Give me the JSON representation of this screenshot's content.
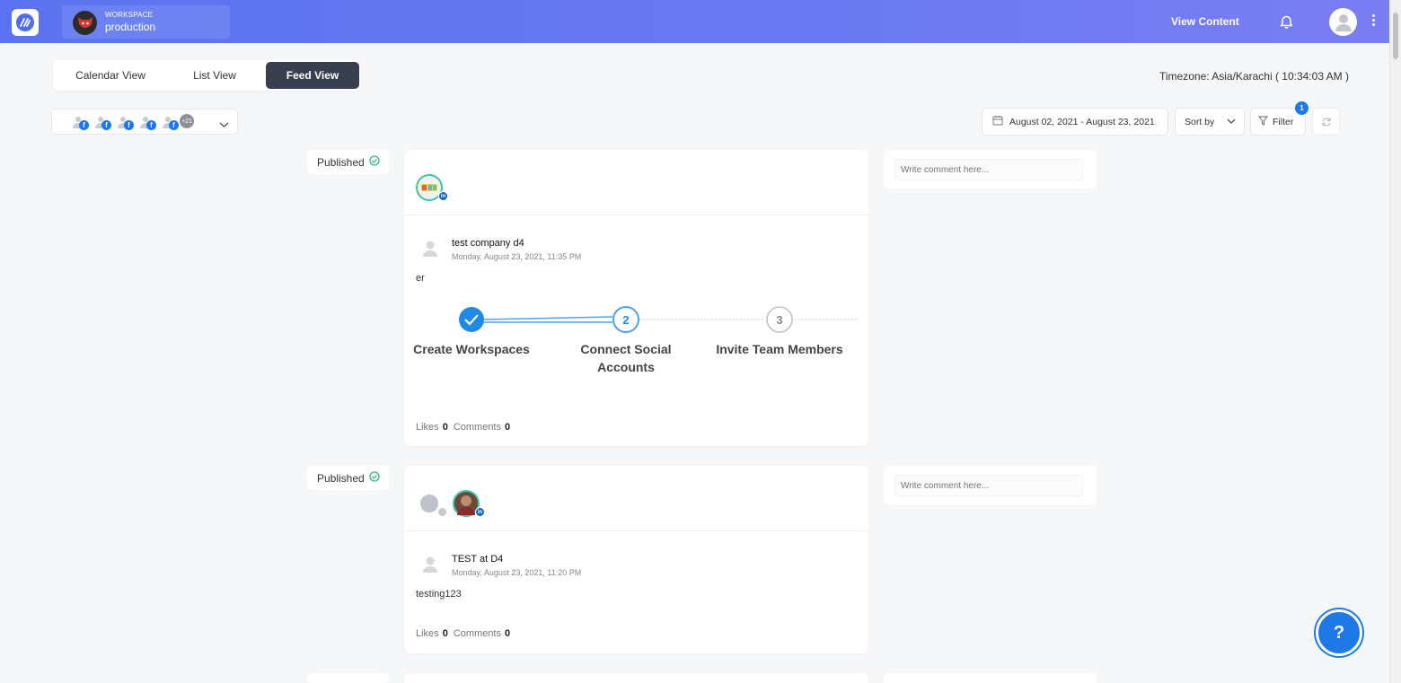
{
  "header": {
    "workspace_label": "WORKSPACE",
    "workspace_name": "production",
    "view_content": "View Content"
  },
  "view_tabs": [
    {
      "label": "Calendar View",
      "active": false
    },
    {
      "label": "List View",
      "active": false
    },
    {
      "label": "Feed View",
      "active": true
    }
  ],
  "timezone": "Timezone: Asia/Karachi ( 10:34:03 AM )",
  "accounts": {
    "more_count": "+21",
    "network_letter": "f"
  },
  "toolbar": {
    "date_range": "August 02, 2021 - August 23, 2021",
    "sort_label": "Sort by",
    "filter_label": "Filter",
    "filter_count": "1"
  },
  "posts": [
    {
      "status": "Published",
      "author": "test company d4",
      "date": "Monday, August 23, 2021, 11:35 PM",
      "text": "er",
      "likes_label": "Likes",
      "likes": "0",
      "comments_label": "Comments",
      "comments": "0",
      "comment_placeholder": "Write comment here...",
      "image_steps": [
        {
          "number": "",
          "label": "Create Workspaces"
        },
        {
          "number": "2",
          "label": "Connect Social\nAccounts"
        },
        {
          "number": "3",
          "label": "Invite Team Members"
        }
      ]
    },
    {
      "status": "Published",
      "author": "TEST at D4",
      "date": "Monday, August 23, 2021, 11:20 PM",
      "text": "testing123",
      "likes_label": "Likes",
      "likes": "0",
      "comments_label": "Comments",
      "comments": "0",
      "comment_placeholder": "Write comment here..."
    }
  ],
  "help_label": "?",
  "colors": {
    "header_gradient_start": "#5b73f0",
    "active_tab": "#38404f",
    "accent_blue": "#1e78e6",
    "published_green": "#2ebf7f"
  }
}
